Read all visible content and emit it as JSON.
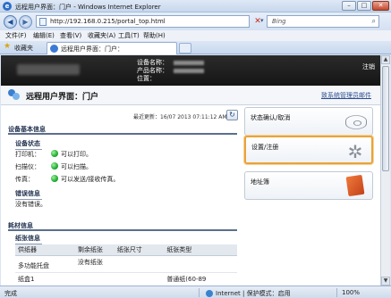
{
  "window": {
    "title": "远程用户界面：门户 - Windows Internet Explorer",
    "min": "–",
    "max": "□",
    "close": "✕"
  },
  "address": {
    "url": "http://192.168.0.215/portal_top.html",
    "search_placeholder": "Bing"
  },
  "menu": [
    "文件(F)",
    "编辑(E)",
    "查看(V)",
    "收藏夹(A)",
    "工具(T)",
    "帮助(H)"
  ],
  "favorites_label": "收藏夹",
  "tab_label": "远程用户界面：门户：",
  "header": {
    "device_name_label": "设备名称：",
    "product_name_label": "产品名称：",
    "location_label": "位置：",
    "logout": "注销"
  },
  "page": {
    "title": "远程用户界面：门户",
    "mail_admin": "致系统管理员邮件",
    "last_updated": "最近更新：16/07 2013 07:11:12 AM"
  },
  "device_basic": {
    "title": "设备基本信息",
    "status_title": "设备状态",
    "rows": [
      {
        "label": "打印机：",
        "text": "可以打印。"
      },
      {
        "label": "扫描仪：",
        "text": "可以扫描。"
      },
      {
        "label": "传真：",
        "text": "可以发送/接收传真。"
      }
    ],
    "error_title": "错误信息",
    "error_text": "没有错误。"
  },
  "consumables": {
    "title": "耗材信息",
    "paper_title": "纸张信息",
    "columns": [
      "供纸器",
      "剩余纸张",
      "纸张尺寸",
      "纸张类型"
    ],
    "rows": [
      [
        "多功能托盘",
        "没有纸张",
        "",
        ""
      ],
      [
        "纸盒1",
        "",
        "",
        "普通纸(60-89"
      ]
    ]
  },
  "cards": [
    {
      "label": "状态确认/取消",
      "icon": "eye-icon"
    },
    {
      "label": "设置/注册",
      "icon": "gear-icon",
      "highlighted": true
    },
    {
      "label": "地址簿",
      "icon": "book-icon"
    }
  ],
  "statusbar": {
    "done": "完成",
    "zone": "Internet | 保护模式：启用",
    "zoom": "100%"
  }
}
